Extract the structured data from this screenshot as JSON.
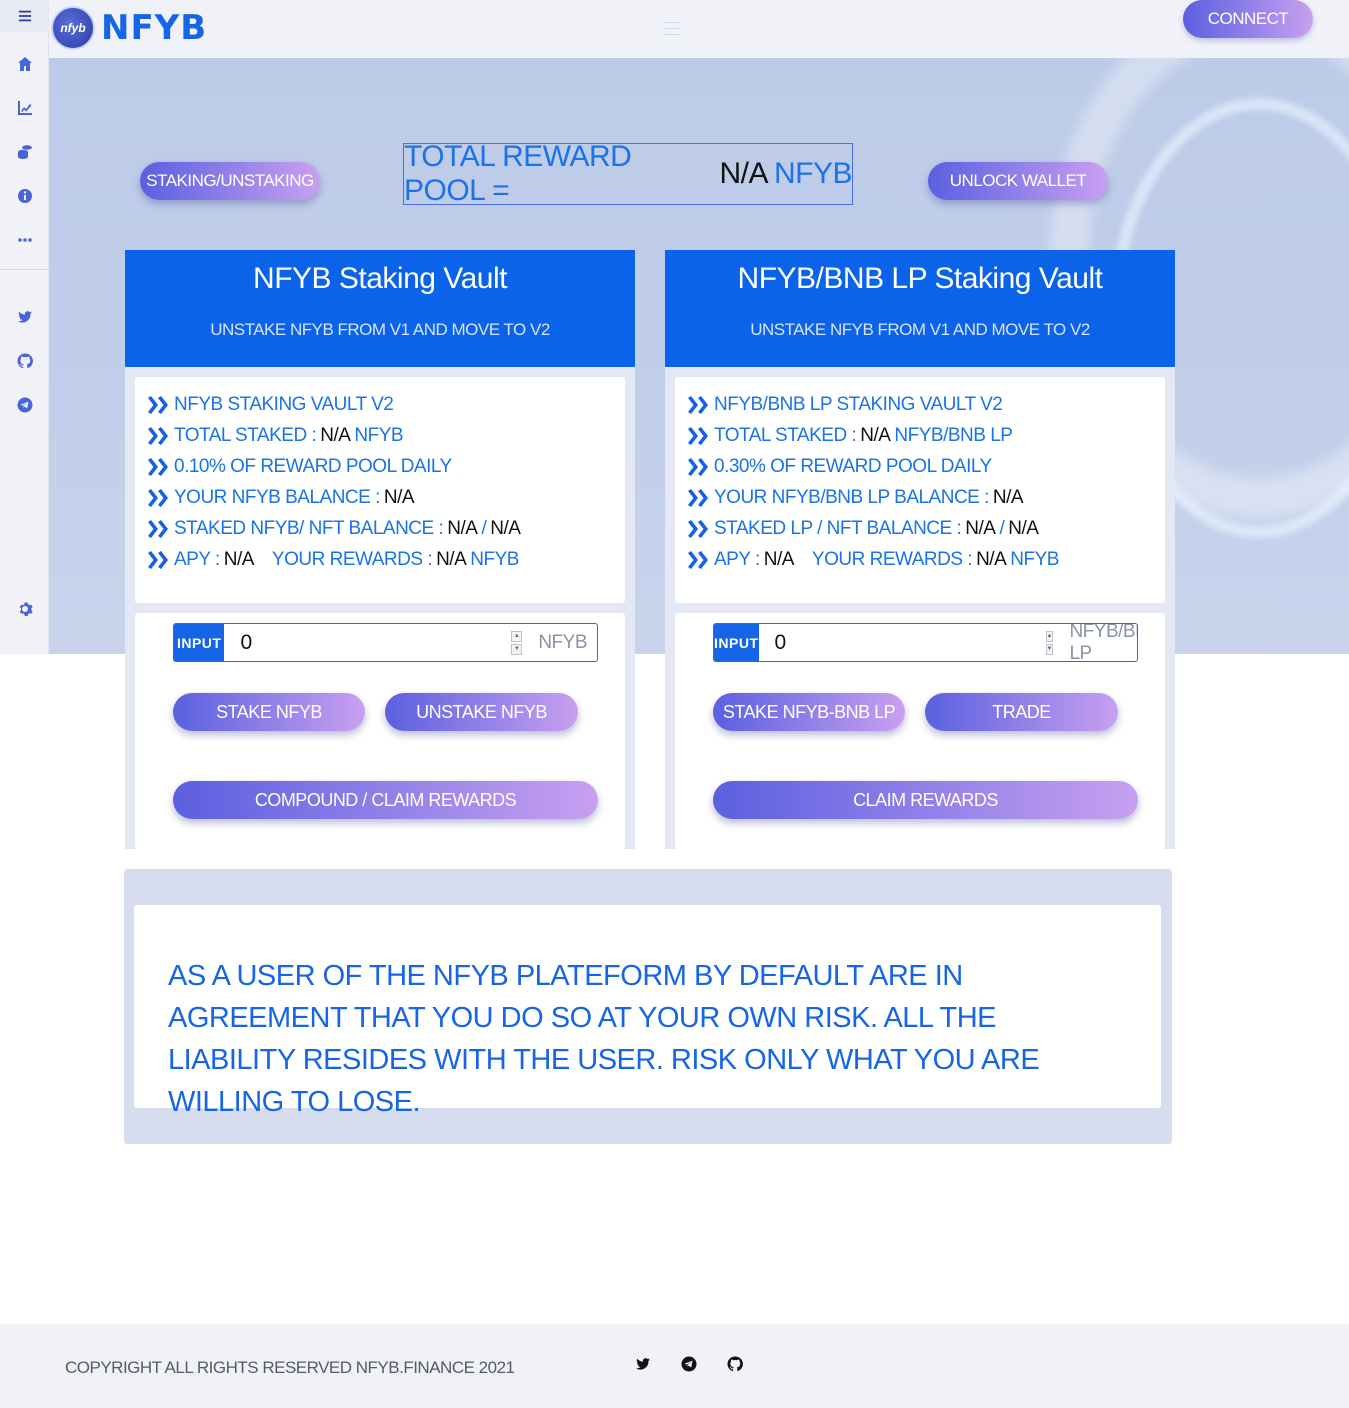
{
  "brand": {
    "logo_text": "NFYB",
    "logo_mark": "nfyb"
  },
  "header": {
    "connect_label": "CONNECT"
  },
  "sidebar": {
    "items": [
      "menu-icon",
      "home-icon",
      "chart-line-icon",
      "coins-icon",
      "info-icon",
      "ellipsis-icon",
      "twitter-icon",
      "github-icon",
      "telegram-icon",
      "gear-icon"
    ]
  },
  "hero": {
    "staking_button": "STAKING/UNSTAKING",
    "unlock_button": "UNLOCK WALLET",
    "reward_pool_label": "TOTAL REWARD POOL =",
    "reward_pool_value": "N/A",
    "reward_pool_unit": "NFYB"
  },
  "vaults": [
    {
      "title": "NFYB Staking Vault",
      "subtitle": "UNSTAKE NFYB FROM V1 AND MOVE TO V2",
      "lines": {
        "name": "NFYB STAKING VAULT V2",
        "total_staked_label": "TOTAL STAKED :",
        "total_staked_value": "N/A",
        "total_staked_unit": "NFYB",
        "reward_daily": "0.10% OF REWARD POOL DAILY",
        "balance_label": "YOUR NFYB BALANCE :",
        "balance_value": "N/A",
        "staked_label": "STAKED NFYB/ NFT BALANCE :",
        "staked_value_1": "N/A",
        "staked_sep": "/",
        "staked_value_2": "N/A",
        "apy_label": "APY :",
        "apy_value": "N/A",
        "rewards_label": "YOUR REWARDS :",
        "rewards_value": "N/A",
        "rewards_unit": "NFYB"
      },
      "input": {
        "label": "INPUT",
        "value": "0",
        "unit": "NFYB"
      },
      "buttons": {
        "primary": "STAKE NFYB",
        "secondary": "UNSTAKE NFYB",
        "wide": "COMPOUND / CLAIM REWARDS"
      }
    },
    {
      "title": "NFYB/BNB LP Staking Vault",
      "subtitle": "UNSTAKE NFYB FROM V1 AND MOVE TO V2",
      "lines": {
        "name": "NFYB/BNB LP STAKING VAULT V2",
        "total_staked_label": "TOTAL STAKED :",
        "total_staked_value": "N/A",
        "total_staked_unit": "NFYB/BNB LP",
        "reward_daily": "0.30% OF REWARD POOL DAILY",
        "balance_label": "YOUR NFYB/BNB LP BALANCE :",
        "balance_value": "N/A",
        "staked_label": "STAKED LP / NFT BALANCE :",
        "staked_value_1": "N/A",
        "staked_sep": "/",
        "staked_value_2": "N/A",
        "apy_label": "APY :",
        "apy_value": "N/A",
        "rewards_label": "YOUR REWARDS :",
        "rewards_value": "N/A",
        "rewards_unit": "NFYB"
      },
      "input": {
        "label": "INPUT",
        "value": "0",
        "unit": "NFYB/BNB LP"
      },
      "buttons": {
        "primary": "STAKE NFYB-BNB LP",
        "secondary": "TRADE",
        "wide": "CLAIM REWARDS"
      }
    }
  ],
  "disclaimer": {
    "text": "AS A USER OF THE NFYB PLATEFORM BY DEFAULT ARE IN AGREEMENT THAT YOU DO SO AT YOUR OWN RISK. ALL THE LIABILITY RESIDES WITH THE USER. RISK ONLY WHAT YOU ARE WILLING TO LOSE."
  },
  "footer": {
    "copyright": "COPYRIGHT ALL RIGHTS RESERVED NFYB.FINANCE 2021",
    "icons": [
      "twitter-icon",
      "telegram-icon",
      "github-icon"
    ]
  },
  "colors": {
    "accent": "#0a63e8",
    "text_blue": "#1a73e8",
    "gradient_start": "#5a60e0",
    "gradient_end": "#c8a0f0"
  }
}
